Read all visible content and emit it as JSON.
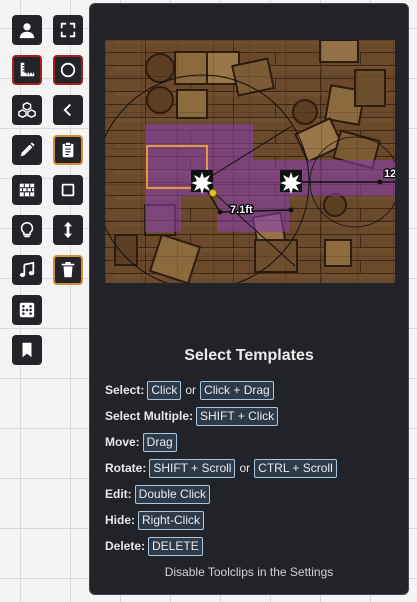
{
  "toolbar": {
    "tools": [
      {
        "name": "token-tool",
        "icon": "user-icon",
        "active": false
      },
      {
        "name": "fullscreen-tool",
        "icon": "expand-icon",
        "active": false
      },
      {
        "name": "measure-tool",
        "icon": "ruler-icon",
        "active": true
      },
      {
        "name": "circle-template-tool",
        "icon": "circle-icon",
        "active": true
      },
      {
        "name": "tiles-tool",
        "icon": "cubes-icon",
        "active": false
      },
      {
        "name": "collapse-tool",
        "icon": "chevron-left-icon",
        "active": false
      },
      {
        "name": "drawing-tool",
        "icon": "pencil-icon",
        "active": false
      },
      {
        "name": "journal-tool",
        "icon": "clipboard-icon",
        "active": false
      },
      {
        "name": "walls-tool",
        "icon": "brick-wall-icon",
        "active": false
      },
      {
        "name": "rectangle-template-tool",
        "icon": "square-icon",
        "active": false
      },
      {
        "name": "lighting-tool",
        "icon": "lightbulb-icon",
        "active": false
      },
      {
        "name": "flip-vertical-tool",
        "icon": "up-down-arrow-icon",
        "active": false
      },
      {
        "name": "sounds-tool",
        "icon": "music-note-icon",
        "active": false
      },
      {
        "name": "delete-tool",
        "icon": "trash-icon",
        "active": false
      },
      {
        "name": "dice-tool",
        "icon": "dice-icon",
        "active": false
      },
      {
        "name": "notes-tool",
        "icon": "bookmark-icon",
        "active": false
      }
    ]
  },
  "tooltip": {
    "title": "Select Templates",
    "preview": {
      "measure_label": "7.1ft",
      "edge_label": "12."
    },
    "rows": [
      {
        "label": "Select:",
        "keys": [
          "Click",
          "Click + Drag"
        ],
        "joiner": "or"
      },
      {
        "label": "Select Multiple:",
        "keys": [
          "SHIFT + Click"
        ],
        "joiner": ""
      },
      {
        "label": "Move:",
        "keys": [
          "Drag"
        ],
        "joiner": ""
      },
      {
        "label": "Rotate:",
        "keys": [
          "SHIFT + Scroll",
          "CTRL + Scroll"
        ],
        "joiner": "or"
      },
      {
        "label": "Edit:",
        "keys": [
          "Double Click"
        ],
        "joiner": ""
      },
      {
        "label": "Hide:",
        "keys": [
          "Right-Click"
        ],
        "joiner": ""
      },
      {
        "label": "Delete:",
        "keys": [
          "DELETE"
        ],
        "joiner": ""
      }
    ],
    "footer": "Disable Toolclips in the Settings"
  },
  "colors": {
    "tool_bg": "#23232a",
    "active_border": "#a4201f",
    "highlight_border": "#d18e32",
    "tooltip_bg": "#222229",
    "kbd_border": "#a9c6e0",
    "template_fill": "#8a3fb5"
  }
}
